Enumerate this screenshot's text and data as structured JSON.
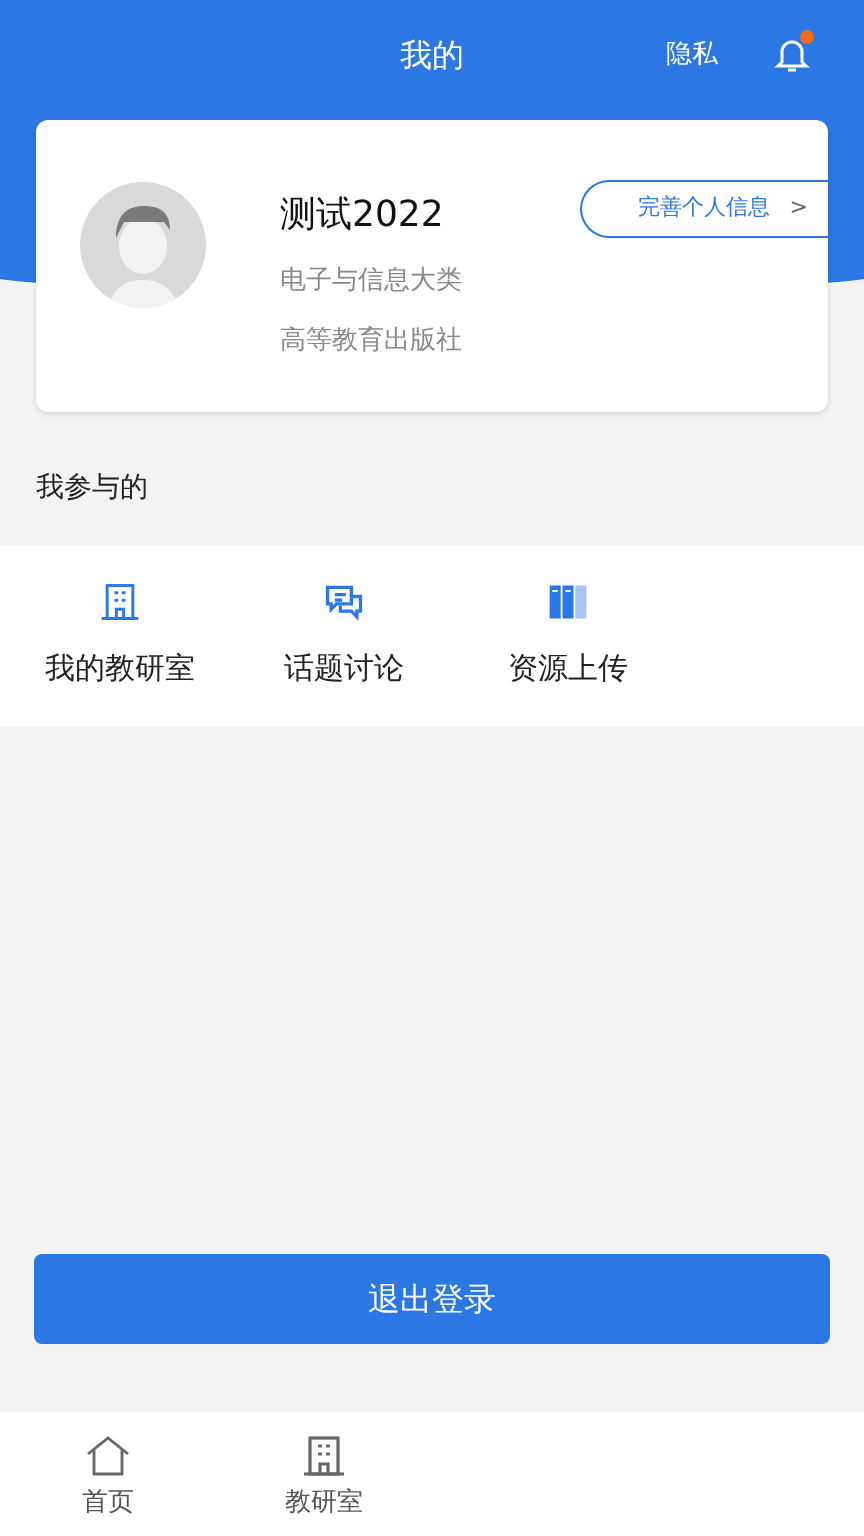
{
  "header": {
    "title": "我的",
    "privacy": "隐私",
    "notification_dot": true
  },
  "profile": {
    "name": "测试2022",
    "category": "电子与信息大类",
    "organization": "高等教育出版社",
    "edit_button": "完善个人信息",
    "edit_arrow": ">"
  },
  "section_title": "我参与的",
  "features": [
    {
      "kind": "building",
      "label": "我的教研室"
    },
    {
      "kind": "chat",
      "label": "话题讨论"
    },
    {
      "kind": "books",
      "label": "资源上传"
    }
  ],
  "logout_button": "退出登录",
  "tab_bar": [
    {
      "kind": "home",
      "label": "首页"
    },
    {
      "kind": "building",
      "label": "教研室"
    }
  ]
}
